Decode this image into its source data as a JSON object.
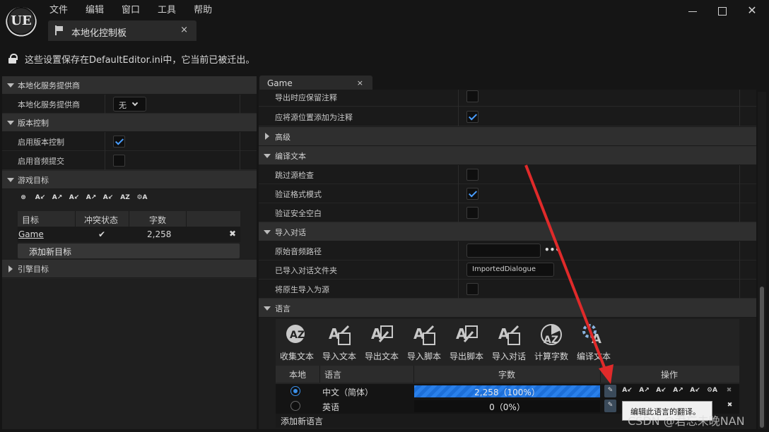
{
  "app": {
    "logo_text": "UE"
  },
  "menu": [
    "文件",
    "编辑",
    "窗口",
    "工具",
    "帮助"
  ],
  "main_tab": {
    "label": "本地化控制板",
    "close": "×"
  },
  "notice": "这些设置保存在DefaultEditor.ini中，它当前已被迁出。",
  "left": {
    "sections": {
      "provider": "本地化服务提供商",
      "version": "版本控制",
      "game_targets": "游戏目标",
      "engine_targets": "引擎目标"
    },
    "provider_row": {
      "label": "本地化服务提供商",
      "value": "无"
    },
    "vc_rows": [
      {
        "label": "启用版本控制",
        "checked": true
      },
      {
        "label": "启用音频提交",
        "checked": false
      }
    ],
    "toolbar_icons": [
      "gather-icon",
      "import-text-icon",
      "export-text-icon",
      "import-script-icon",
      "export-script-icon",
      "import-dialogue-icon",
      "count-words-icon",
      "compile-text-icon"
    ],
    "table": {
      "headers": [
        "目标",
        "冲突状态",
        "字数"
      ],
      "row": {
        "target": "Game",
        "conflict": "✔",
        "words": "2,258",
        "delete": "✖"
      }
    },
    "add_target": "添加新目标"
  },
  "right": {
    "tab": {
      "label": "Game",
      "close": "×"
    },
    "rows": {
      "export_comments": "导出时应保留注释",
      "add_source_location": "应将源位置添加为注释",
      "advanced": "高级",
      "compile_text": "编译文本",
      "skip_source_check": "跳过源检查",
      "validate_format": "验证格式模式",
      "validate_whitespace": "验证安全空白",
      "import_dialogue": "导入对话",
      "raw_audio_path": "原始音频路径",
      "imported_dialogue_folder": "已导入对话文件夹",
      "import_native_as_source": "将原生导入为源",
      "language": "语言"
    },
    "imported_dialogue_value": "ImportedDialogue",
    "browse_dots": "•••",
    "lang_tools": [
      "收集文本",
      "导入文本",
      "导出文本",
      "导入脚本",
      "导出脚本",
      "导入对话",
      "计算字数",
      "编译文本"
    ],
    "lang_headers": [
      "本地",
      "语言",
      "字数",
      "操作"
    ],
    "languages": [
      {
        "name": "中文（简体）",
        "progress_text": "2,258（100%）",
        "progress": 1.0,
        "native": true
      },
      {
        "name": "英语",
        "progress_text": "0（0%）",
        "progress": 0.0,
        "native": false
      }
    ],
    "add_language": "添加新语言",
    "tooltip": "编辑此语言的翻译。"
  },
  "watermark": "CSDN @君忘未晚NAN",
  "colors": {
    "accent": "#1e6fd0",
    "check": "#4a9eff",
    "green": "#25c025",
    "arrow": "#e02a2a"
  }
}
